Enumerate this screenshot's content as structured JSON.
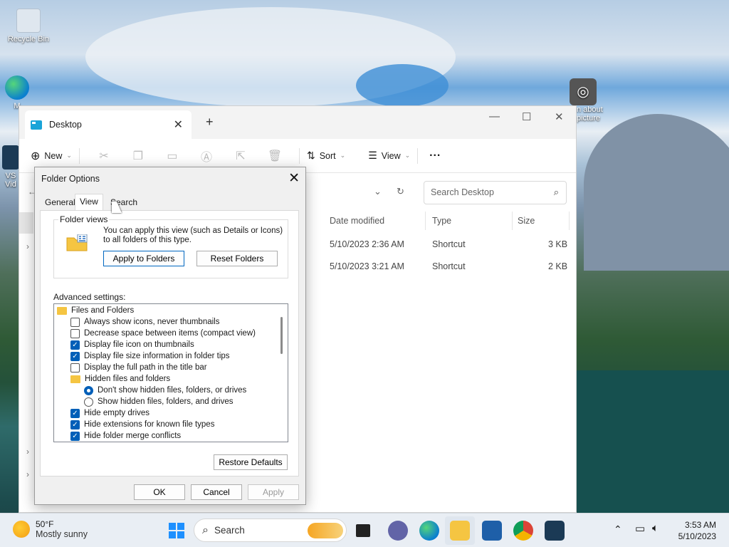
{
  "desktop": {
    "recycle_bin": "Recycle Bin",
    "edge_partial": "M",
    "vs_partial1": "VS",
    "vs_partial2": "Vid",
    "camera_label1": "n about",
    "camera_label2": "picture"
  },
  "explorer": {
    "tab_title": "Desktop",
    "toolbar": {
      "new": "New",
      "sort": "Sort",
      "view": "View",
      "more": "···"
    },
    "search_placeholder": "Search Desktop",
    "columns": {
      "date": "Date modified",
      "type": "Type",
      "size": "Size"
    },
    "rows": [
      {
        "date": "5/10/2023 2:36 AM",
        "type": "Shortcut",
        "size": "3 KB"
      },
      {
        "date": "5/10/2023 3:21 AM",
        "type": "Shortcut",
        "size": "2 KB"
      }
    ]
  },
  "dialog": {
    "title": "Folder Options",
    "tabs": [
      "General",
      "View",
      "Search"
    ],
    "folder_views": {
      "label": "Folder views",
      "text": "You can apply this view (such as Details or Icons) to all folders of this type.",
      "apply_button": "Apply to Folders",
      "reset_button": "Reset Folders"
    },
    "advanced_label": "Advanced settings:",
    "settings": {
      "root": "Files and Folders",
      "items": [
        {
          "label": "Always show icons, never thumbnails",
          "checked": false
        },
        {
          "label": "Decrease space between items (compact view)",
          "checked": false
        },
        {
          "label": "Display file icon on thumbnails",
          "checked": true
        },
        {
          "label": "Display file size information in folder tips",
          "checked": true
        },
        {
          "label": "Display the full path in the title bar",
          "checked": false
        }
      ],
      "hidden_group": "Hidden files and folders",
      "radios": [
        {
          "label": "Don't show hidden files, folders, or drives",
          "selected": true
        },
        {
          "label": "Show hidden files, folders, and drives",
          "selected": false
        }
      ],
      "more_items": [
        {
          "label": "Hide empty drives",
          "checked": true
        },
        {
          "label": "Hide extensions for known file types",
          "checked": true
        },
        {
          "label": "Hide folder merge conflicts",
          "checked": true
        }
      ]
    },
    "restore_button": "Restore Defaults",
    "ok": "OK",
    "cancel": "Cancel",
    "apply": "Apply"
  },
  "taskbar": {
    "weather_temp": "50°F",
    "weather_desc": "Mostly sunny",
    "search_label": "Search",
    "time": "3:53 AM",
    "date": "5/10/2023"
  },
  "colors": {
    "accent": "#005fb8",
    "folder": "#f5c542"
  }
}
